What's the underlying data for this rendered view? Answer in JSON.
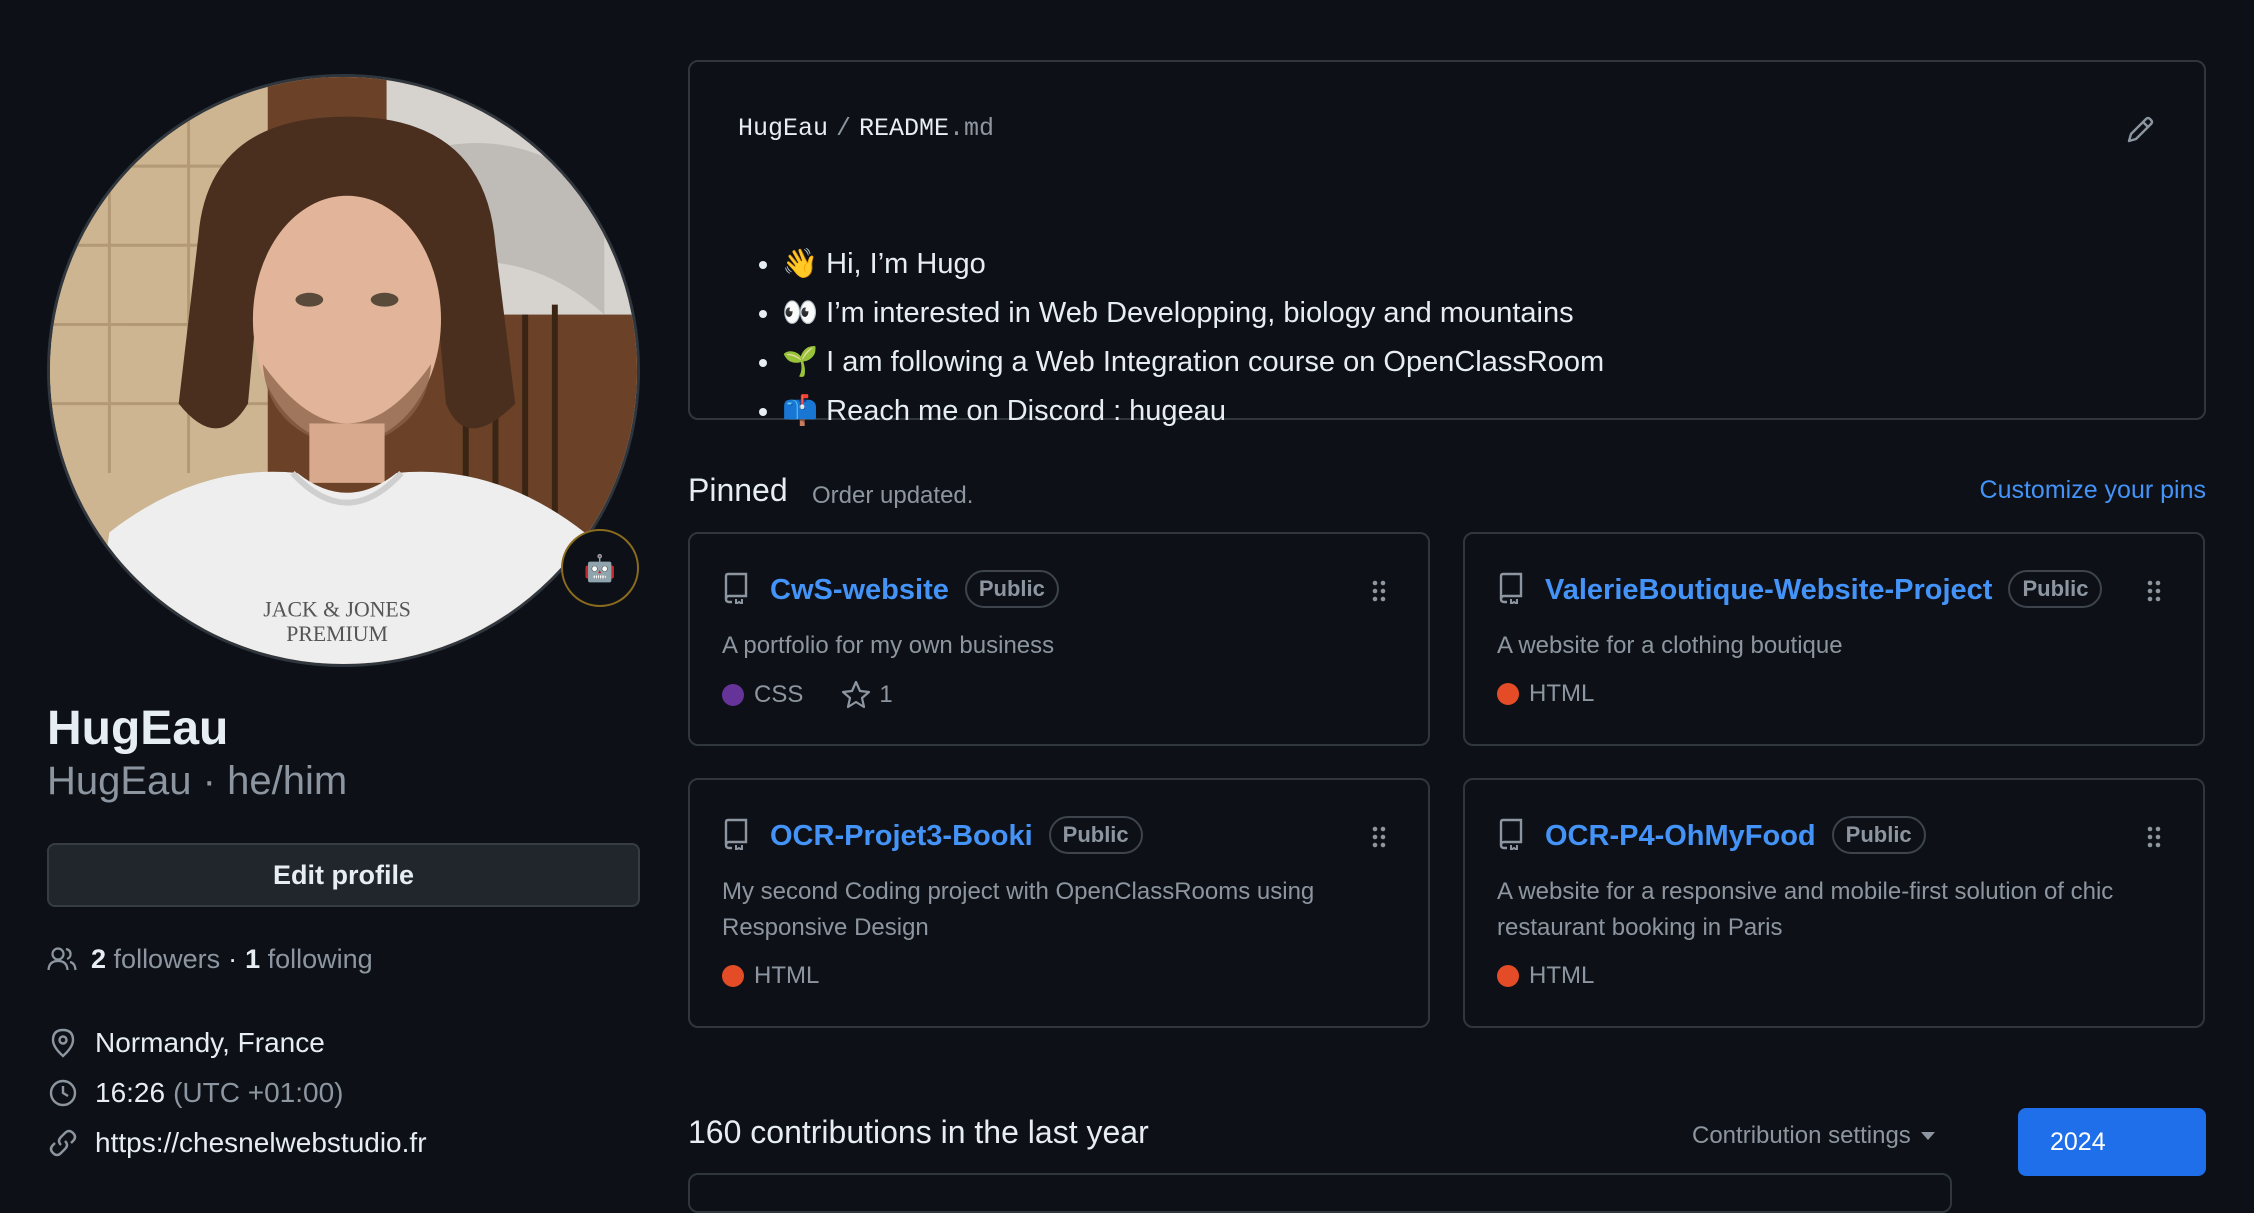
{
  "profile": {
    "display_name": "HugEau",
    "username_pronouns": "HugEau · he/him",
    "status_emoji": "🤖",
    "edit_profile_label": "Edit profile",
    "followers_count": "2",
    "followers_label": "followers",
    "separator": "·",
    "following_count": "1",
    "following_label": "following",
    "location": "Normandy, France",
    "local_time": "16:26",
    "timezone": "(UTC +01:00)",
    "website": "https://chesnelwebstudio.fr"
  },
  "readme": {
    "owner": "HugEau",
    "path_sep": "/",
    "file_base": "README",
    "file_ext": ".md",
    "items": [
      "👋 Hi, I’m Hugo",
      "👀 I’m interested in Web Developping, biology and mountains",
      "🌱 I am following a Web Integration course on OpenClassRoom",
      "📫 Reach me on Discord : hugeau"
    ]
  },
  "pinned": {
    "title": "Pinned",
    "status": "Order updated.",
    "customize_label": "Customize your pins",
    "repos": [
      {
        "name": "CwS-website",
        "visibility": "Public",
        "description": "A portfolio for my own business",
        "language": "CSS",
        "language_color": "#663399",
        "stars": "1"
      },
      {
        "name": "ValerieBoutique-Website-Project",
        "visibility": "Public",
        "description": "A website for a clothing boutique",
        "language": "HTML",
        "language_color": "#e34c26"
      },
      {
        "name": "OCR-Projet3-Booki",
        "visibility": "Public",
        "description": "My second Coding project with OpenClassRooms using Responsive Design",
        "language": "HTML",
        "language_color": "#e34c26"
      },
      {
        "name": "OCR-P4-OhMyFood",
        "visibility": "Public",
        "description": "A website for a responsive and mobile-first solution of chic restaurant booking in Paris",
        "language": "HTML",
        "language_color": "#e34c26"
      }
    ]
  },
  "contributions": {
    "title": "160 contributions in the last year",
    "settings_label": "Contribution settings",
    "year": "2024"
  },
  "colors": {
    "background": "#0d1117",
    "link": "#4493f8",
    "muted": "#8d96a0",
    "border": "#30363d",
    "year_button": "#1f6feb"
  }
}
